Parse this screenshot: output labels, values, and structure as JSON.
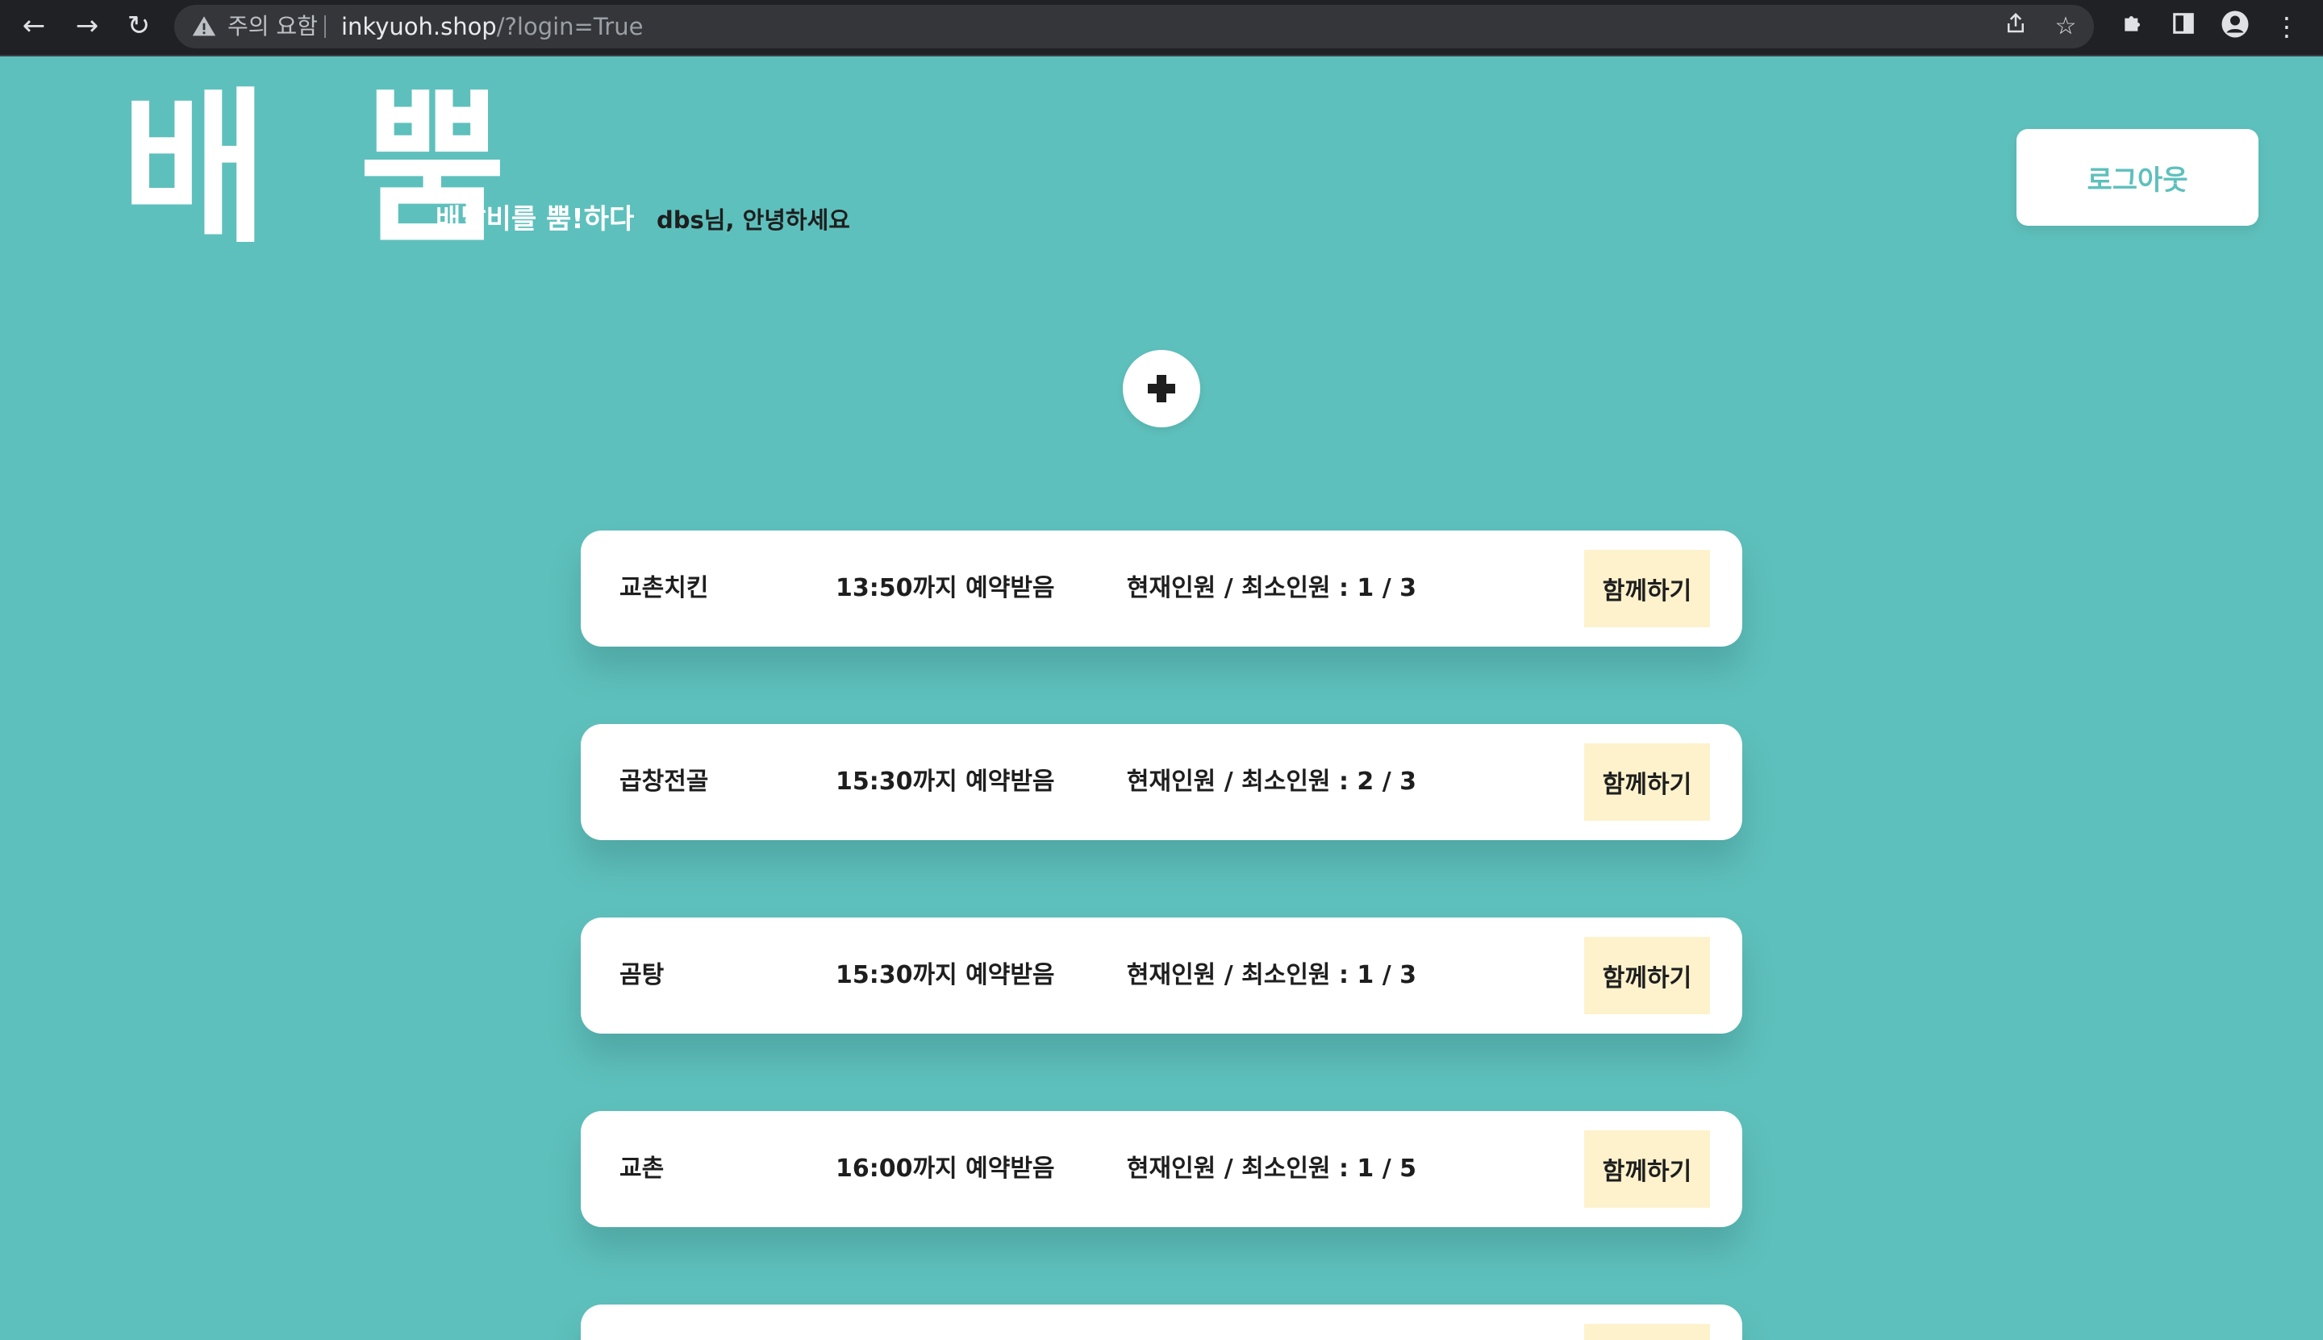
{
  "browser": {
    "security_label": "주의 요함",
    "url_host": "inkyuoh.shop",
    "url_path": "/?login=True"
  },
  "header": {
    "logo": "배 뿜",
    "slogan": "배달비를 뿜!하다",
    "greeting": "dbs님, 안녕하세요",
    "logout_label": "로그아웃"
  },
  "actions": {
    "add_label": "+"
  },
  "cards": [
    {
      "name": "교촌치킨",
      "deadline": "13:50까지 예약받음",
      "count": "현재인원 / 최소인원 : 1 / 3",
      "join": "함께하기"
    },
    {
      "name": "곱창전골",
      "deadline": "15:30까지 예약받음",
      "count": "현재인원 / 최소인원 : 2 / 3",
      "join": "함께하기"
    },
    {
      "name": "곰탕",
      "deadline": "15:30까지 예약받음",
      "count": "현재인원 / 최소인원 : 1 / 3",
      "join": "함께하기"
    },
    {
      "name": "교촌",
      "deadline": "16:00까지 예약받음",
      "count": "현재인원 / 최소인원 : 1 / 5",
      "join": "함께하기"
    }
  ],
  "icons": {
    "back": "arrow-left",
    "forward": "arrow-right",
    "reload": "reload",
    "warning": "warning-triangle",
    "share": "share",
    "bookmark": "star",
    "extensions": "puzzle",
    "side_panel": "side-panel",
    "profile": "person",
    "menu": "kebab"
  },
  "colors": {
    "page_bg": "#5ec0bc",
    "card_bg": "#ffffff",
    "join_bg": "#fdf2cc",
    "accent": "#5ec0bc"
  }
}
